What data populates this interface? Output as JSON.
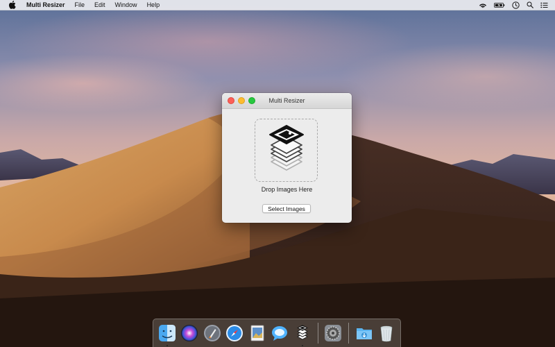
{
  "menubar": {
    "app_name": "Multi Resizer",
    "items": [
      "File",
      "Edit",
      "Window",
      "Help"
    ],
    "status_icons": [
      "wifi-icon",
      "battery-icon",
      "clock-icon",
      "spotlight-search-icon",
      "notification-center-icon"
    ]
  },
  "window": {
    "title": "Multi Resizer",
    "drop_label": "Drop Images Here",
    "select_button": "Select Images"
  },
  "dock": {
    "items": [
      "finder-icon",
      "siri-icon",
      "launchpad-icon",
      "safari-icon",
      "preview-icon",
      "messages-icon",
      "multi-resizer-icon",
      "system-preferences-icon",
      "downloads-folder-icon",
      "trash-icon"
    ]
  },
  "colors": {
    "close": "#fc5f57",
    "minimize": "#fdbc2e",
    "maximize": "#28c840"
  }
}
